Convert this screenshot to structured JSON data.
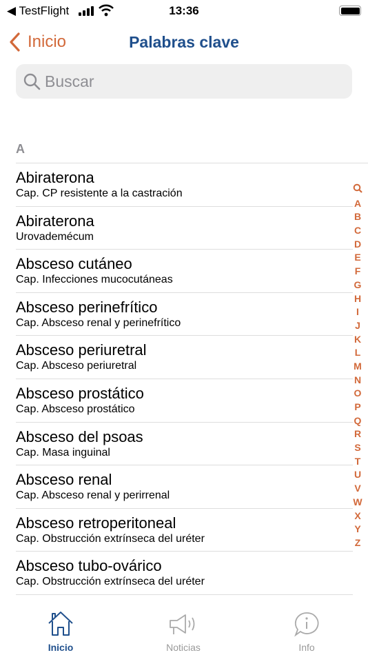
{
  "status": {
    "back_app": "TestFlight",
    "time": "13:36"
  },
  "nav": {
    "back_label": "Inicio",
    "title": "Palabras clave"
  },
  "search": {
    "placeholder": "Buscar",
    "value": ""
  },
  "section": "A",
  "items": [
    {
      "title": "Abiraterona",
      "subtitle": "Cap. CP resistente a la castración"
    },
    {
      "title": "Abiraterona",
      "subtitle": "Urovademécum"
    },
    {
      "title": "Absceso cutáneo",
      "subtitle": "Cap. Infecciones mucocutáneas"
    },
    {
      "title": "Absceso perinefrítico",
      "subtitle": "Cap. Absceso renal y perinefrítico"
    },
    {
      "title": "Absceso periuretral",
      "subtitle": "Cap. Absceso periuretral"
    },
    {
      "title": "Absceso prostático",
      "subtitle": "Cap. Absceso prostático"
    },
    {
      "title": "Absceso del psoas",
      "subtitle": "Cap. Masa inguinal"
    },
    {
      "title": "Absceso renal",
      "subtitle": "Cap. Absceso renal y perirrenal"
    },
    {
      "title": "Absceso retroperitoneal",
      "subtitle": "Cap. Obstrucción extrínseca del uréter"
    },
    {
      "title": "Absceso tubo-ovárico",
      "subtitle": "Cap. Obstrucción extrínseca del uréter"
    }
  ],
  "index": [
    "A",
    "B",
    "C",
    "D",
    "E",
    "F",
    "G",
    "H",
    "I",
    "J",
    "K",
    "L",
    "M",
    "N",
    "O",
    "P",
    "Q",
    "R",
    "S",
    "T",
    "U",
    "V",
    "W",
    "X",
    "Y",
    "Z"
  ],
  "tabs": [
    {
      "label": "Inicio",
      "icon": "house-icon",
      "active": true
    },
    {
      "label": "Noticias",
      "icon": "megaphone-icon"
    },
    {
      "label": "Info",
      "icon": "info-bubble-icon"
    }
  ],
  "colors": {
    "accent": "#d2693a",
    "primary": "#1f4f8c",
    "inactive": "#999999"
  }
}
